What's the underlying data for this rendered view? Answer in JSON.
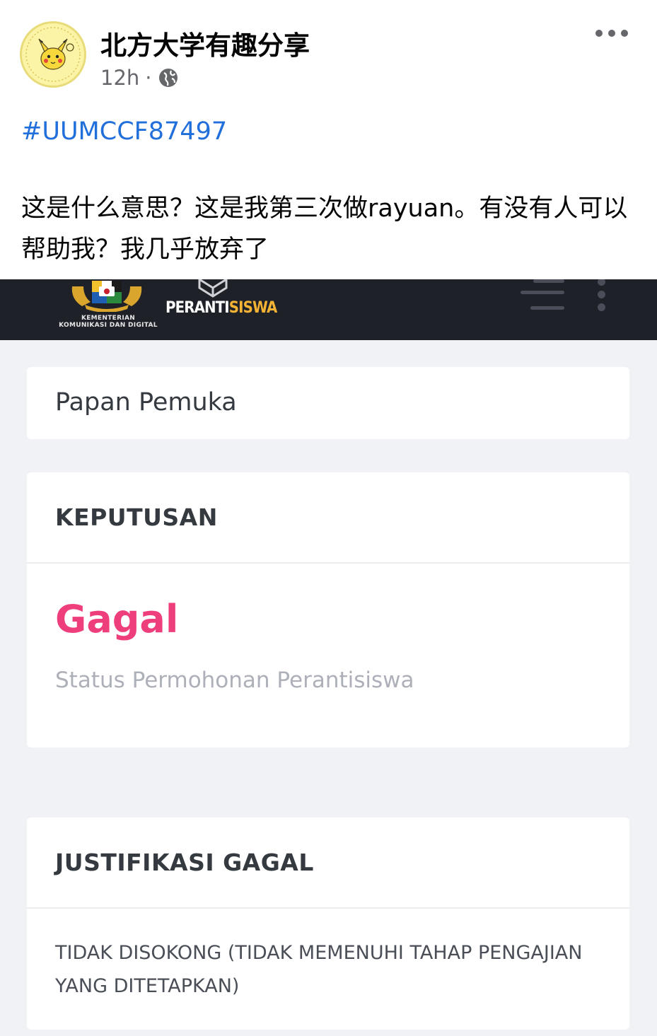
{
  "post": {
    "page_name": "北方大学有趣分享",
    "time": "12h",
    "separator": "·",
    "hashtag": "#UUMCCF87497",
    "text": "这是什么意思？这是我第三次做rayuan。有没有人可以帮助我？我几乎放弃了",
    "icons": {
      "more": "more-options-icon",
      "audience": "globe-icon"
    }
  },
  "app": {
    "ministry_line1": "KEMENTERIAN",
    "ministry_line2": "KOMUNIKASI DAN DIGITAL",
    "brand_part1": "PERANTI",
    "brand_part2": "SISWA",
    "breadcrumb": "Papan Pemuka",
    "decision_title": "KEPUTUSAN",
    "decision_value": "Gagal",
    "decision_label": "Status Permohonan Perantisiswa",
    "justification_title": "JUSTIFIKASI GAGAL",
    "justification_text": "TIDAK DISOKONG (TIDAK MEMENUHI TAHAP PENGAJIAN YANG DITETAPKAN)",
    "colors": {
      "header_bg": "#1f2129",
      "brand_accent": "#f5b335",
      "failed": "#ee3f7c",
      "body_bg": "#f1f2f6"
    }
  }
}
